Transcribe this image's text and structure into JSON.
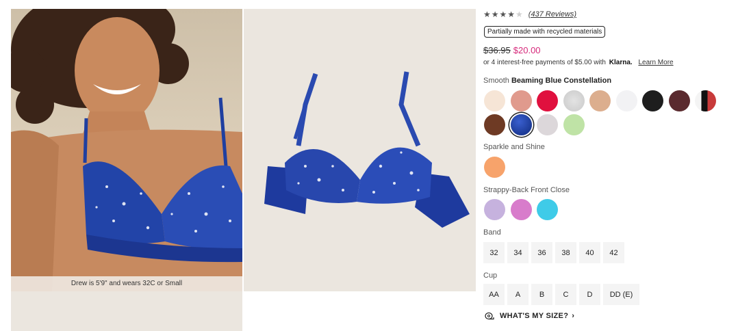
{
  "gallery": {
    "caption": "Drew is 5'9\" and wears 32C or Small"
  },
  "product": {
    "rating": {
      "stars_filled": 4,
      "stars_total": 5,
      "reviews_label": "(437 Reviews)"
    },
    "recycled_badge": "Partially made with recycled materials",
    "price": {
      "original": "$36.95",
      "sale": "$20.00",
      "sale_color": "#d6287a"
    },
    "klarna": {
      "text": "or 4 interest-free payments of $5.00 with",
      "brand": "Klarna.",
      "learn_more": "Learn More"
    }
  },
  "colors": {
    "groups": [
      {
        "name": "Smooth",
        "selected_name": "Beaming Blue Constellation",
        "swatches": [
          {
            "name": "bare",
            "color": "#f6e5d6"
          },
          {
            "name": "rose",
            "color": "#e09a8d"
          },
          {
            "name": "red",
            "color": "#e0103e"
          },
          {
            "name": "heather-grey",
            "color": "#d5d5d5"
          },
          {
            "name": "tan",
            "color": "#dcae8e"
          },
          {
            "name": "white",
            "color": "#f2f2f4"
          },
          {
            "name": "black",
            "color": "#1e1e1e"
          },
          {
            "name": "burgundy",
            "color": "#5a2a2e"
          },
          {
            "name": "print-black",
            "color": "#333333"
          },
          {
            "name": "brown",
            "color": "#6e3a24"
          },
          {
            "name": "beaming-blue-constellation",
            "color": "#223f98",
            "selected": true
          },
          {
            "name": "light-grey",
            "color": "#dcd7da"
          },
          {
            "name": "mint",
            "color": "#bfe3a6"
          }
        ]
      },
      {
        "name": "Sparkle and Shine",
        "swatches": [
          {
            "name": "orange",
            "color": "#f7a36b"
          }
        ]
      },
      {
        "name": "Strappy-Back Front Close",
        "swatches": [
          {
            "name": "lavender",
            "color": "#c6b2de"
          },
          {
            "name": "orchid",
            "color": "#d87ccb"
          },
          {
            "name": "aqua",
            "color": "#3fcbe8"
          }
        ]
      }
    ]
  },
  "sizes": {
    "band_label": "Band",
    "bands": [
      "32",
      "34",
      "36",
      "38",
      "40",
      "42"
    ],
    "cup_label": "Cup",
    "cups": [
      "AA",
      "A",
      "B",
      "C",
      "D",
      "DD (E)"
    ]
  },
  "size_help": {
    "label": "WHAT'S MY SIZE?"
  }
}
